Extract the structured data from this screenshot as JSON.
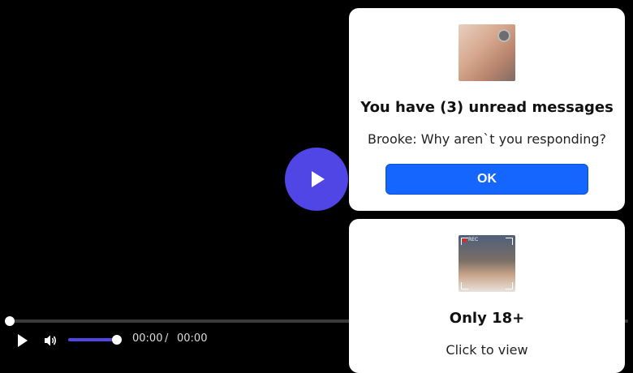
{
  "player": {
    "current_time": "00:00",
    "separator": "/",
    "duration": "00:00",
    "progress": 0,
    "volume": 1,
    "accent_color": "#4f46e5"
  },
  "notification": {
    "title": "You have (3) unread messages",
    "message": "Brooke: Why aren`t you responding?",
    "ok_label": "OK",
    "button_color": "#1466ff"
  },
  "promo": {
    "thumbnail_badge": "REC",
    "title": "Only 18+",
    "text": "Click to view"
  },
  "icons": {
    "big_play": "play-icon",
    "play": "play-icon",
    "volume": "volume-icon"
  }
}
